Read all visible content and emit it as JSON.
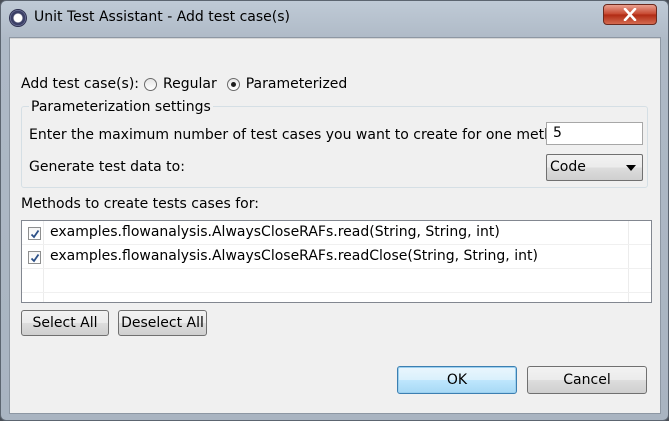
{
  "window": {
    "title": "Unit Test Assistant - Add test case(s)"
  },
  "add_cases": {
    "label": "Add test case(s):",
    "options": [
      {
        "label": "Regular",
        "checked": false
      },
      {
        "label": "Parameterized",
        "checked": true
      }
    ]
  },
  "param_settings": {
    "group_label": "Parameterization settings",
    "max_cases_label": "Enter the maximum number of test cases you want to create for one method:",
    "max_cases_value": "5",
    "generate_label": "Generate test data to:",
    "generate_value": "Code"
  },
  "methods": {
    "label": "Methods to create tests cases for:",
    "items": [
      {
        "label": "examples.flowanalysis.AlwaysCloseRAFs.read(String, String, int)",
        "checked": true
      },
      {
        "label": "examples.flowanalysis.AlwaysCloseRAFs.readClose(String, String, int)",
        "checked": true
      }
    ]
  },
  "buttons": {
    "select_all": "Select All",
    "deselect_all": "Deselect All",
    "ok": "OK",
    "cancel": "Cancel"
  }
}
